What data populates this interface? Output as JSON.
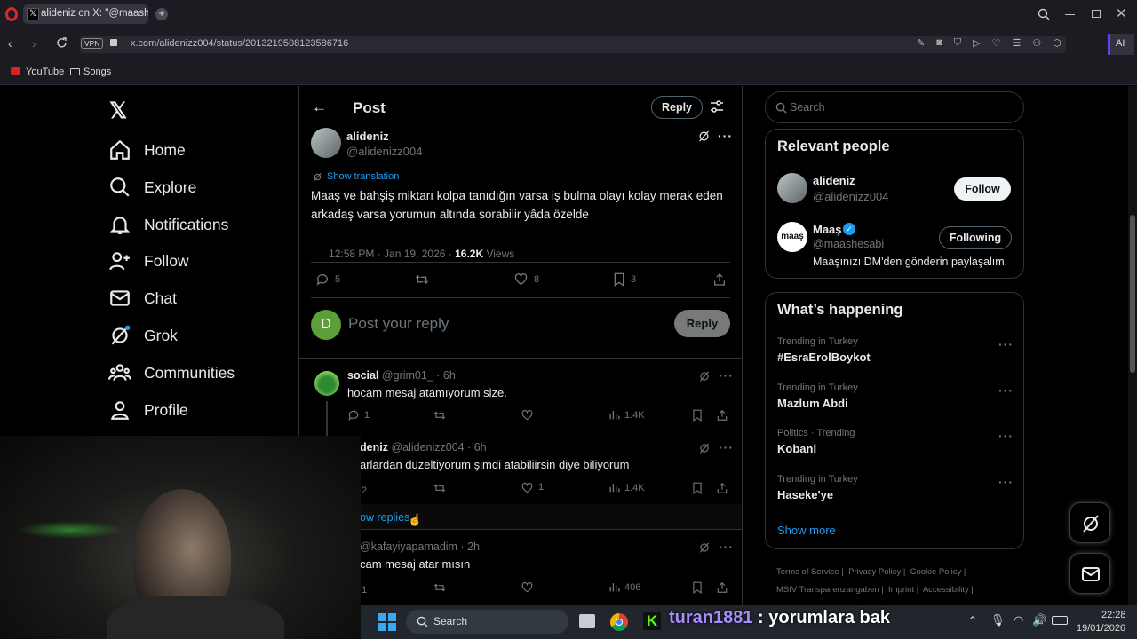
{
  "browser": {
    "tab_title": "alideniz on X: \"@maashes",
    "url": "x.com/alidenizz004/status/2013219508123586716",
    "vpn_label": "VPN",
    "ai_label": "AI",
    "bookmarks": [
      "YouTube",
      "Songs"
    ]
  },
  "sidebar": {
    "items": [
      {
        "label": "Home",
        "icon": "home-icon"
      },
      {
        "label": "Explore",
        "icon": "search-icon"
      },
      {
        "label": "Notifications",
        "icon": "bell-icon"
      },
      {
        "label": "Follow",
        "icon": "person-plus-icon"
      },
      {
        "label": "Chat",
        "icon": "mail-icon"
      },
      {
        "label": "Grok",
        "icon": "grok-icon"
      },
      {
        "label": "Communities",
        "icon": "people-icon"
      },
      {
        "label": "Profile",
        "icon": "person-icon"
      }
    ]
  },
  "header": {
    "title": "Post",
    "reply_button": "Reply"
  },
  "post": {
    "name": "alideniz",
    "handle": "@alidenizz004",
    "translate": "Show translation",
    "text": "Maaş ve bahşiş miktarı kolpa tanıdığın varsa iş bulma olayı kolay merak eden arkadaş varsa yorumun altında sorabilir yâda özelde",
    "time": "12:58 PM · Jan 19, 2026 · ",
    "views": "16.2K",
    "views_label": " Views",
    "replies": "5",
    "likes": "8",
    "bookmarks": "3"
  },
  "composer": {
    "avatar_letter": "D",
    "placeholder": "Post your reply",
    "button": "Reply"
  },
  "replies": [
    {
      "name": "social",
      "handle": "@grim01_ · 6h",
      "text": "hocam mesaj atamıyorum size.",
      "replies": "1",
      "views": "1.4K",
      "likes": ""
    },
    {
      "name": "deniz",
      "handle": "@alidenizz004 · 6h",
      "text": "arlardan düzeltiyorum şimdi atabiliirsin diye biliyorum",
      "replies": "2",
      "views": "1.4K",
      "likes": "1"
    },
    {
      "name": "",
      "handle": "@kafayiyapamadim · 2h",
      "text": "cam mesaj atar mısın",
      "replies": "1",
      "views": "406",
      "likes": ""
    }
  ],
  "show_replies": "ow replies",
  "search": {
    "placeholder": "Search"
  },
  "relevant": {
    "title": "Relevant people",
    "people": [
      {
        "name": "alideniz",
        "handle": "@alidenizz004",
        "button": "Follow"
      },
      {
        "name": "Maaş",
        "handle": "@maashesabi",
        "button": "Following",
        "bio": "Maaşınızı DM'den gönderin paylaşalım.",
        "avatar_text": "maaş"
      }
    ]
  },
  "happening": {
    "title": "What’s happening",
    "trends": [
      {
        "context": "Trending in Turkey",
        "name": "#EsraErolBoykot"
      },
      {
        "context": "Trending in Turkey",
        "name": "Mazlum Abdi"
      },
      {
        "context": "Politics · Trending",
        "name": "Kobani"
      },
      {
        "context": "Trending in Turkey",
        "name": "Haseke'ye"
      }
    ],
    "show_more": "Show more"
  },
  "footer": [
    "Terms of Service",
    "|",
    "Privacy Policy",
    "|",
    "Cookie Policy",
    "|",
    "MStV Transparenzangaben",
    "|",
    "Imprint",
    "|",
    "Accessibility",
    "|"
  ],
  "taskbar": {
    "search": "Search",
    "chat_user": "turan1881",
    "chat_text": " : yorumlara bak",
    "time": "22:28",
    "date": "19/01/2026"
  },
  "colors": {
    "accent": "#1d9bf0",
    "background": "#000000",
    "border": "#2f3336",
    "muted": "#71767b"
  }
}
